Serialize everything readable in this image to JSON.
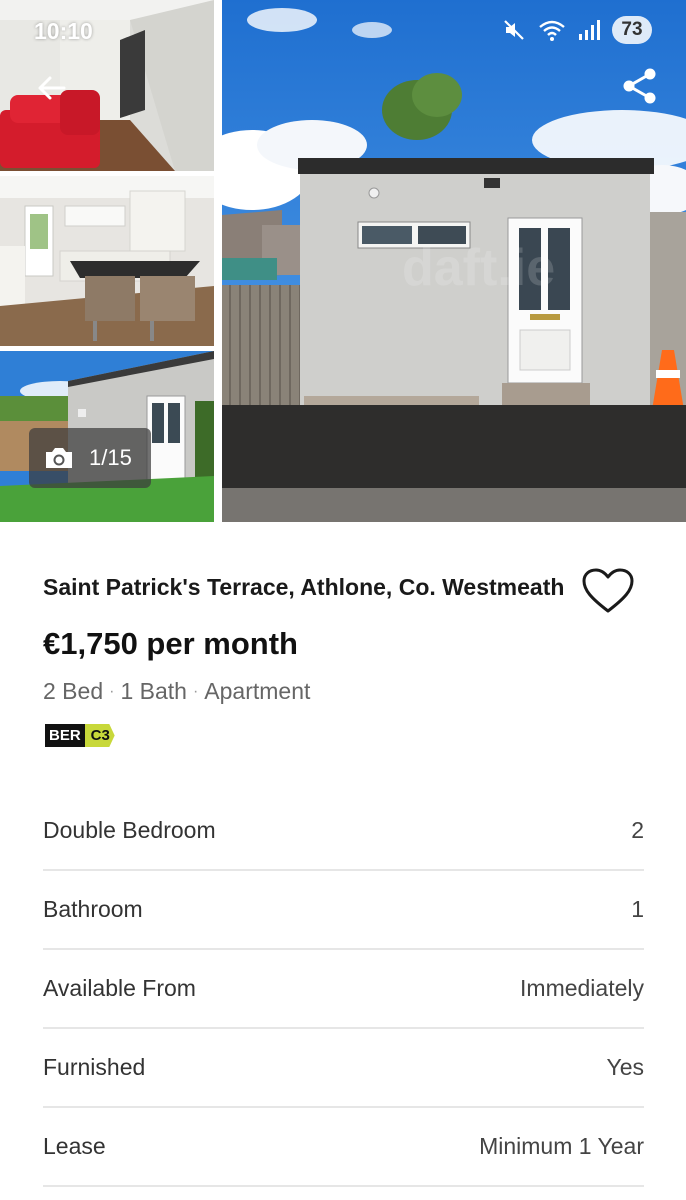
{
  "status_bar": {
    "time": "10:10",
    "battery": "73"
  },
  "gallery": {
    "photo_counter": "1/15",
    "watermark": "daft.ie"
  },
  "listing": {
    "address": "Saint Patrick's Terrace, Athlone, Co. Westmeath",
    "price": "€1,750 per month",
    "beds": "2 Bed",
    "baths": "1 Bath",
    "property_type": "Apartment",
    "ber_label": "BER",
    "ber_rating": "C3"
  },
  "facts": [
    {
      "label": "Double Bedroom",
      "value": "2"
    },
    {
      "label": "Bathroom",
      "value": "1"
    },
    {
      "label": "Available From",
      "value": "Immediately"
    },
    {
      "label": "Furnished",
      "value": "Yes"
    },
    {
      "label": "Lease",
      "value": "Minimum 1 Year"
    }
  ],
  "colors": {
    "ber_rating": "#c8d83a",
    "sky": "#2f7fd6",
    "accent_text": "#1a1a1a"
  },
  "icons": [
    "back-arrow-icon",
    "share-icon",
    "camera-icon",
    "heart-outline-icon",
    "mute-icon",
    "wifi-icon",
    "signal-icon"
  ]
}
